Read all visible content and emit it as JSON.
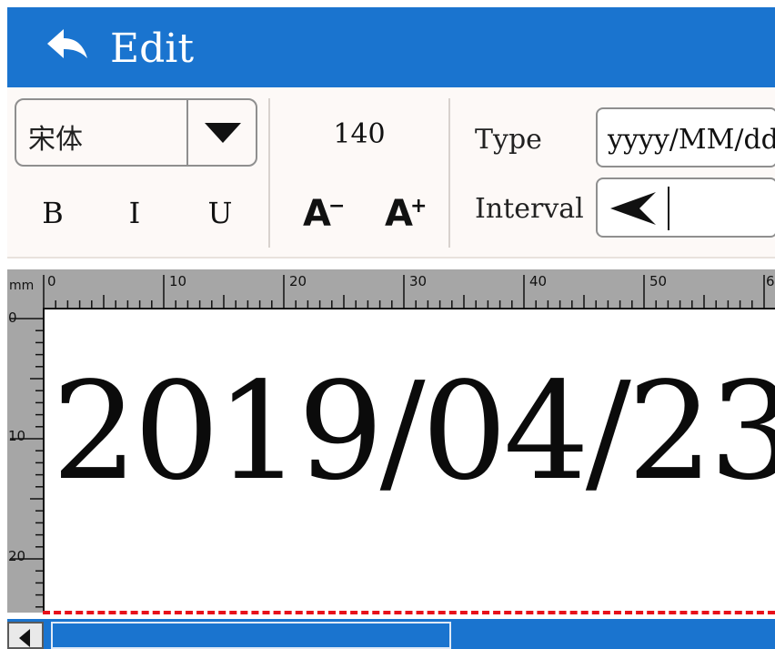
{
  "header": {
    "title": "Edit",
    "back_icon": "back-arrow-icon",
    "background": "#1a74cf"
  },
  "toolbar": {
    "font": {
      "selected": "宋体",
      "dropdown_icon": "chevron-down-icon"
    },
    "styles": {
      "bold": "B",
      "italic": "I",
      "underline": "U"
    },
    "font_size": "140",
    "size_buttons": {
      "decrease": "A",
      "decrease_mark": "−",
      "increase": "A",
      "increase_mark": "+"
    },
    "type": {
      "label": "Type",
      "value": "yyyy/MM/dd"
    },
    "interval": {
      "label": "Interval",
      "icon": "arrow-left-icon"
    }
  },
  "ruler": {
    "unit": "mm",
    "top_labels": [
      "0",
      "10",
      "20",
      "30",
      "40",
      "50",
      "6"
    ],
    "left_labels": [
      "0",
      "10",
      "20"
    ]
  },
  "canvas": {
    "text": "2019/04/23",
    "boundary_color": "#e8101a"
  }
}
